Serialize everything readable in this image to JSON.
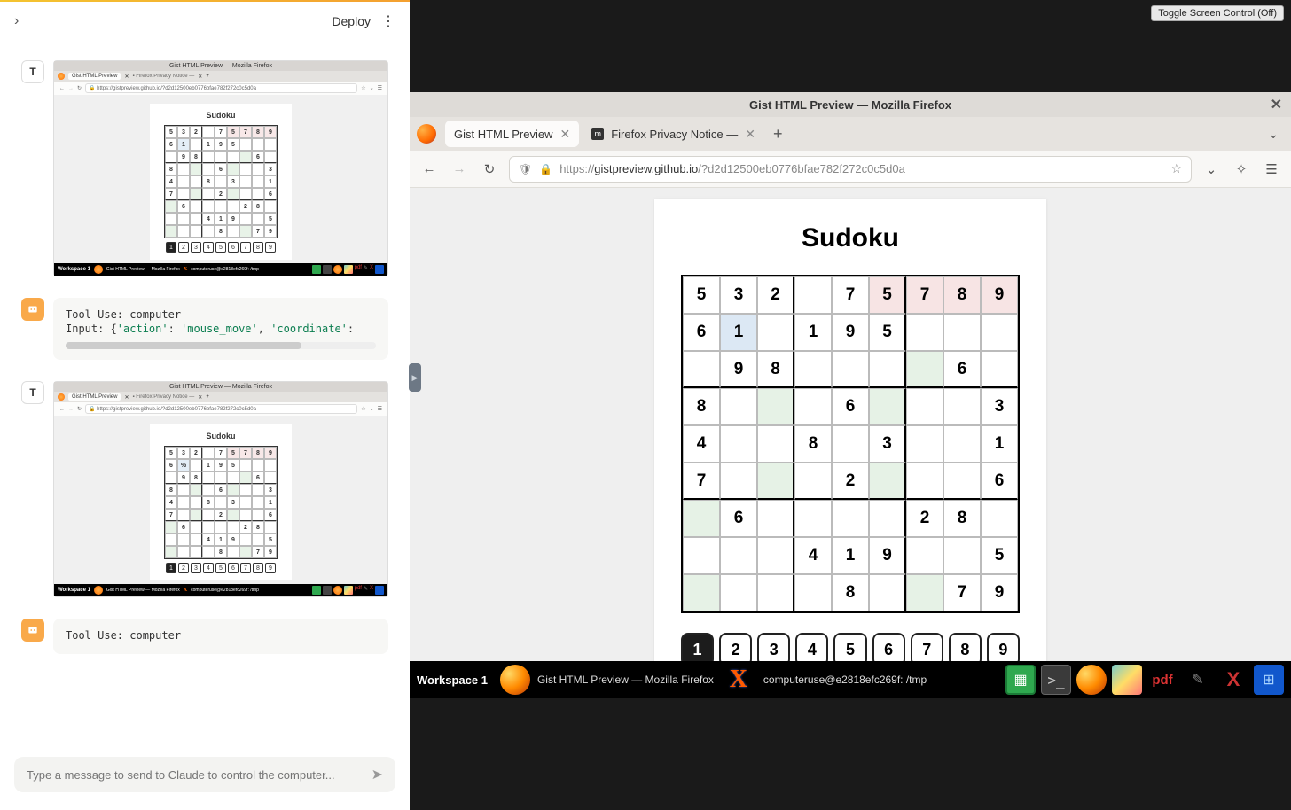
{
  "left_panel": {
    "deploy_label": "Deploy",
    "messages": [
      {
        "type": "thumb",
        "avatar": "T"
      },
      {
        "type": "tool",
        "avatar": "bot",
        "line1": "Tool Use: computer",
        "line2_prefix": "Input: {",
        "key1": "'action'",
        "val1": "'mouse_move'",
        "key2": "'coordinate'",
        "colon": ": ",
        "suffix": ":"
      },
      {
        "type": "thumb",
        "avatar": "T"
      },
      {
        "type": "tool2",
        "avatar": "bot",
        "line1": "Tool Use: computer"
      }
    ],
    "input_placeholder": "Type a message to send to Claude to control the computer..."
  },
  "mini": {
    "title": "Gist HTML Preview — Mozilla Firefox",
    "tab1": "Gist HTML Preview",
    "tab2": "Firefox Privacy Notice —",
    "url": "https://gistpreview.github.io/?d2d12500eb0776bfae782f272c0c5d0a",
    "heading": "Sudoku"
  },
  "toggle_label": "Toggle Screen Control (Off)",
  "browser": {
    "title": "Gist HTML Preview — Mozilla Firefox",
    "tab1": "Gist HTML Preview",
    "tab2": "Firefox Privacy Notice —",
    "url_domain": "gistpreview.github.io",
    "url_prefix": "https://",
    "url_suffix": "/?d2d12500eb0776bfae782f272c0c5d0a"
  },
  "sudoku": {
    "title": "Sudoku",
    "grid": [
      [
        "5",
        "3",
        "2",
        "",
        "7",
        "5",
        "7",
        "8",
        "9"
      ],
      [
        "6",
        "1",
        "",
        "1",
        "9",
        "5",
        "",
        "",
        ""
      ],
      [
        "",
        "9",
        "8",
        "",
        "",
        "",
        "",
        "6",
        ""
      ],
      [
        "8",
        "",
        "",
        "",
        "6",
        "",
        "",
        "",
        "3"
      ],
      [
        "4",
        "",
        "",
        "8",
        "",
        "3",
        "",
        "",
        "1"
      ],
      [
        "7",
        "",
        "",
        "",
        "2",
        "",
        "",
        "",
        "6"
      ],
      [
        "",
        "6",
        "",
        "",
        "",
        "",
        "2",
        "8",
        ""
      ],
      [
        "",
        "",
        "",
        "4",
        "1",
        "9",
        "",
        "",
        "5"
      ],
      [
        "",
        "",
        "",
        "",
        "8",
        "",
        "",
        "7",
        "9"
      ]
    ],
    "color_map": [
      [
        "",
        "",
        "",
        "",
        "",
        "p",
        "p",
        "p",
        "p"
      ],
      [
        "",
        "b",
        "",
        "",
        "",
        "",
        "",
        "",
        ""
      ],
      [
        "",
        "",
        "",
        "",
        "",
        "",
        "g",
        "",
        ""
      ],
      [
        "",
        "",
        "g",
        "",
        "",
        "g",
        "",
        "",
        ""
      ],
      [
        "",
        "",
        "",
        "",
        "",
        "",
        "",
        "",
        ""
      ],
      [
        "",
        "",
        "g",
        "",
        "",
        "g",
        "",
        "",
        ""
      ],
      [
        "g",
        "",
        "",
        "",
        "",
        "",
        "",
        "",
        ""
      ],
      [
        "",
        "",
        "",
        "",
        "",
        "",
        "",
        "",
        ""
      ],
      [
        "g",
        "",
        "",
        "",
        "",
        "",
        "g",
        "",
        ""
      ]
    ],
    "numpad": [
      "1",
      "2",
      "3",
      "4",
      "5",
      "6",
      "7",
      "8",
      "9"
    ],
    "selected": "1"
  },
  "taskbar": {
    "workspace": "Workspace 1",
    "app": "Gist HTML Preview — Mozilla Firefox",
    "term": "computeruse@e2818efc269f: /tmp",
    "pdf": "pdf"
  }
}
